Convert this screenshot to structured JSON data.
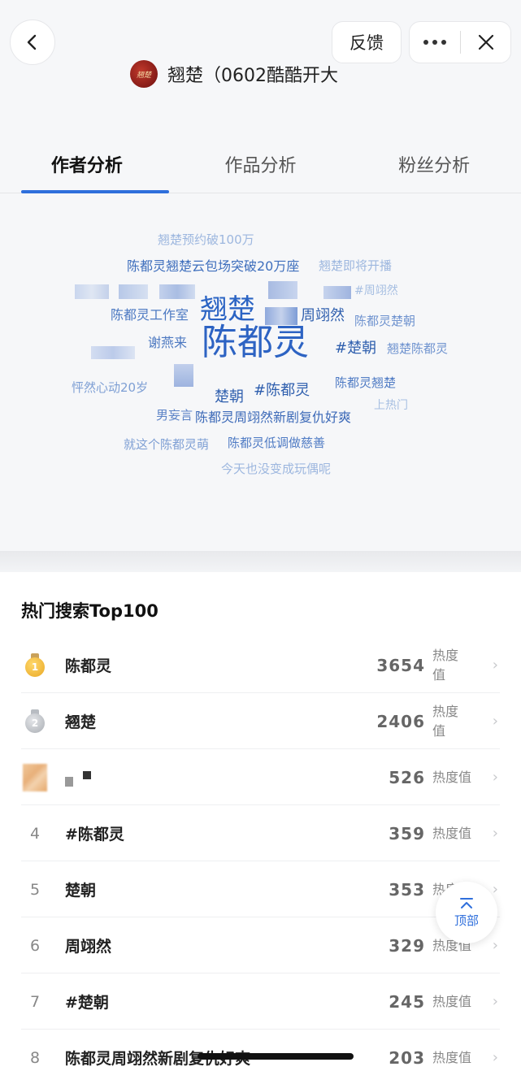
{
  "header": {
    "feedback_label": "反馈",
    "author_name": "翘楚（0602酷酷开大",
    "avatar_text": "翘楚"
  },
  "tabs": [
    {
      "label": "作者分析",
      "active": true
    },
    {
      "label": "作品分析",
      "active": false
    },
    {
      "label": "粉丝分析",
      "active": false
    }
  ],
  "word_cloud": {
    "words": [
      "翘楚预约破100万",
      "陈都灵翘楚云包场突破20万座",
      "翘楚即将开播",
      "#周翊然",
      "陈都灵工作室",
      "翘楚",
      "周翊然",
      "陈都灵楚朝",
      "谢燕来",
      "陈都灵",
      "#楚朝",
      "翘楚陈都灵",
      "陈都灵翘楚",
      "怦然心动20岁",
      "楚朝",
      "#陈都灵",
      "上热门",
      "男妄言",
      "陈都灵周翊然新剧复仇好爽",
      "就这个陈都灵萌",
      "陈都灵低调做慈善",
      "今天也没变成玩偶呢"
    ]
  },
  "hot_search": {
    "title": "热门搜索Top100",
    "unit_label": "热度值",
    "rows": [
      {
        "rank": "1",
        "term": "陈都灵",
        "score": "3654"
      },
      {
        "rank": "2",
        "term": "翘楚",
        "score": "2406"
      },
      {
        "rank": "3",
        "term": "",
        "score": "526"
      },
      {
        "rank": "4",
        "term": "#陈都灵",
        "score": "359"
      },
      {
        "rank": "5",
        "term": "楚朝",
        "score": "353"
      },
      {
        "rank": "6",
        "term": "周翊然",
        "score": "329"
      },
      {
        "rank": "7",
        "term": "#楚朝",
        "score": "245"
      },
      {
        "rank": "8",
        "term": "陈都灵周翊然新剧复仇好爽",
        "score": "203"
      }
    ]
  },
  "back_to_top_label": "顶部",
  "colors": {
    "accent": "#2f6fdc",
    "cloud_dark": "#2b5fb0",
    "cloud_light": "#8fb0de",
    "gold": "#e9a825",
    "silver": "#a9adb3"
  }
}
